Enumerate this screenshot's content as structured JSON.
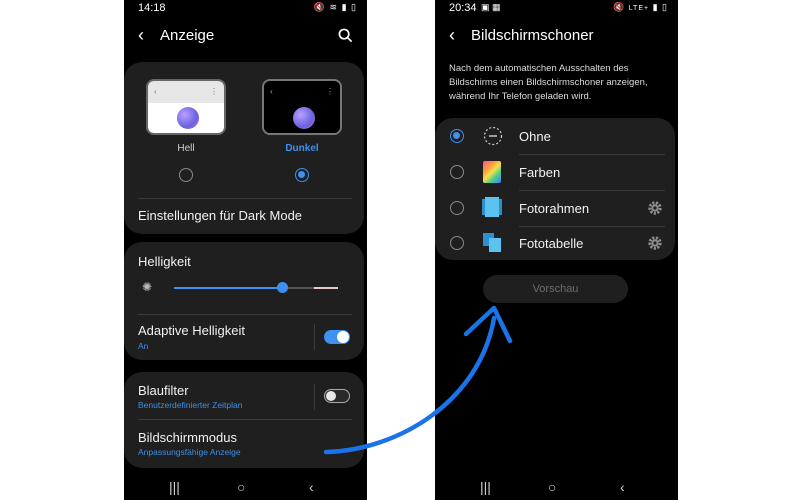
{
  "left_screen": {
    "status": {
      "time": "14:18"
    },
    "appbar": {
      "title": "Anzeige",
      "back_icon": "‹",
      "search_icon": "search-icon"
    },
    "theme": {
      "light_label": "Hell",
      "dark_label": "Dunkel",
      "selected": "dark",
      "dark_mode_settings": "Einstellungen für Dark Mode"
    },
    "brightness": {
      "label": "Helligkeit",
      "level": 0.66,
      "adaptive_label": "Adaptive Helligkeit",
      "adaptive_status": "An",
      "adaptive_on": true
    },
    "blue_filter": {
      "label": "Blaufilter",
      "sublabel": "Benutzerdefinierter Zeitplan",
      "on": false
    },
    "screensaver": {
      "label": "Bildschirmmodus",
      "sublabel": "Anpassungsfähige Anzeige"
    }
  },
  "right_screen": {
    "status": {
      "time": "20:34",
      "network": "LTE+"
    },
    "appbar": {
      "title": "Bildschirmschoner",
      "back_icon": "‹"
    },
    "description": "Nach dem automatischen Ausschalten des Bildschirms einen Bildschirmschoner anzeigen, während Ihr Telefon geladen wird.",
    "options": [
      {
        "label": "Ohne",
        "icon": "none-icon",
        "selected": true,
        "has_settings": false
      },
      {
        "label": "Farben",
        "icon": "colors-icon",
        "selected": false,
        "has_settings": false
      },
      {
        "label": "Fotorahmen",
        "icon": "photo-frame-icon",
        "selected": false,
        "has_settings": true
      },
      {
        "label": "Fototabelle",
        "icon": "photo-table-icon",
        "selected": false,
        "has_settings": true
      }
    ],
    "preview_label": "Vorschau"
  },
  "nav": {
    "recents": "|||",
    "home": "○",
    "back": "‹"
  },
  "colors": {
    "accent": "#3e91f0",
    "card": "#1f1f1f",
    "arrow": "#1a73e8"
  }
}
